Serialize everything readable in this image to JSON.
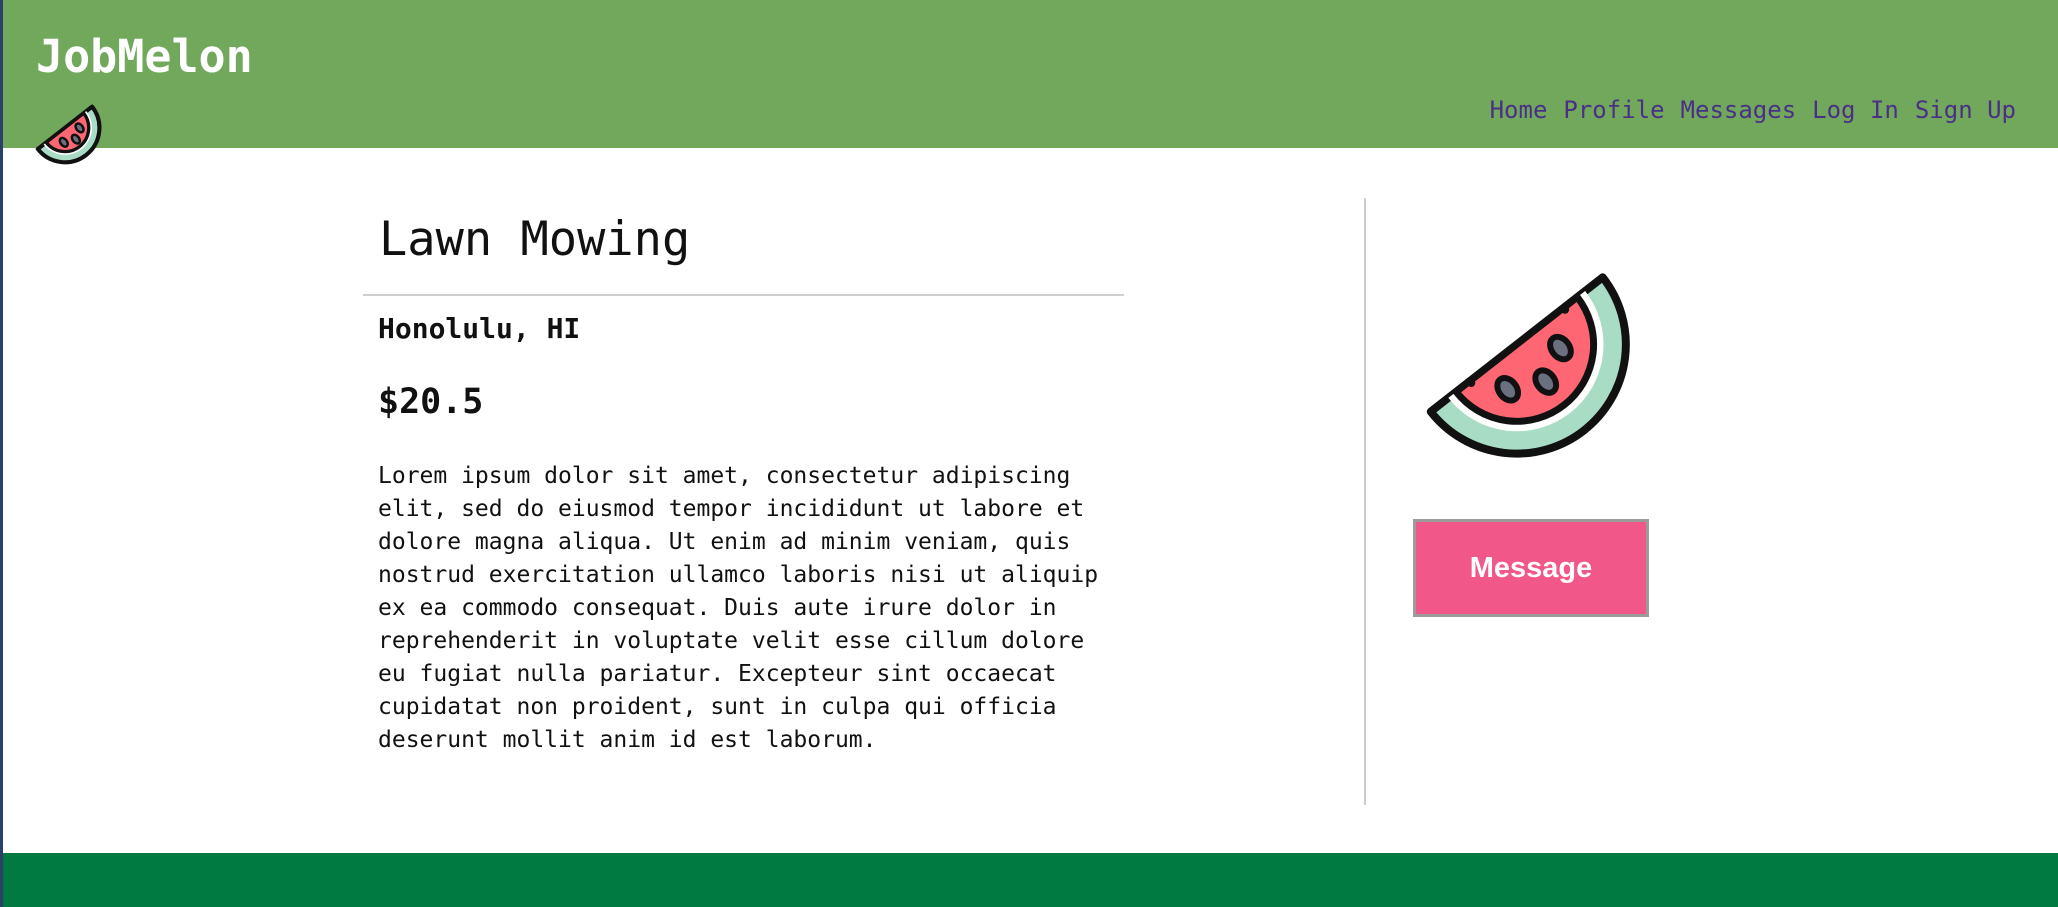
{
  "header": {
    "brand": "JobMelon",
    "logo_icon": "watermelon-icon",
    "nav": {
      "home": "Home",
      "profile": "Profile",
      "messages": "Messages",
      "login": "Log In",
      "signup": "Sign Up"
    }
  },
  "job": {
    "title": "Lawn Mowing",
    "location": "Honolulu, HI",
    "price": "$20.5",
    "description": "Lorem ipsum dolor sit amet, consectetur adipiscing elit, sed do eiusmod tempor incididunt ut labore et dolore magna aliqua. Ut enim ad minim veniam, quis nostrud exercitation ullamco laboris nisi ut aliquip ex ea commodo consequat. Duis aute irure dolor in reprehenderit in voluptate velit esse cillum dolore eu fugiat nulla pariatur. Excepteur sint occaecat cupidatat non proident, sunt in culpa qui officia deserunt mollit anim id est laborum."
  },
  "side": {
    "image_icon": "watermelon-icon",
    "message_label": "Message"
  },
  "colors": {
    "header_bg": "#72a85c",
    "footer_bg": "#007a40",
    "nav_link": "#4a2f86",
    "button_bg": "#f2578a",
    "melon_flesh": "#ff6673",
    "melon_rind": "#a8dcc4"
  }
}
